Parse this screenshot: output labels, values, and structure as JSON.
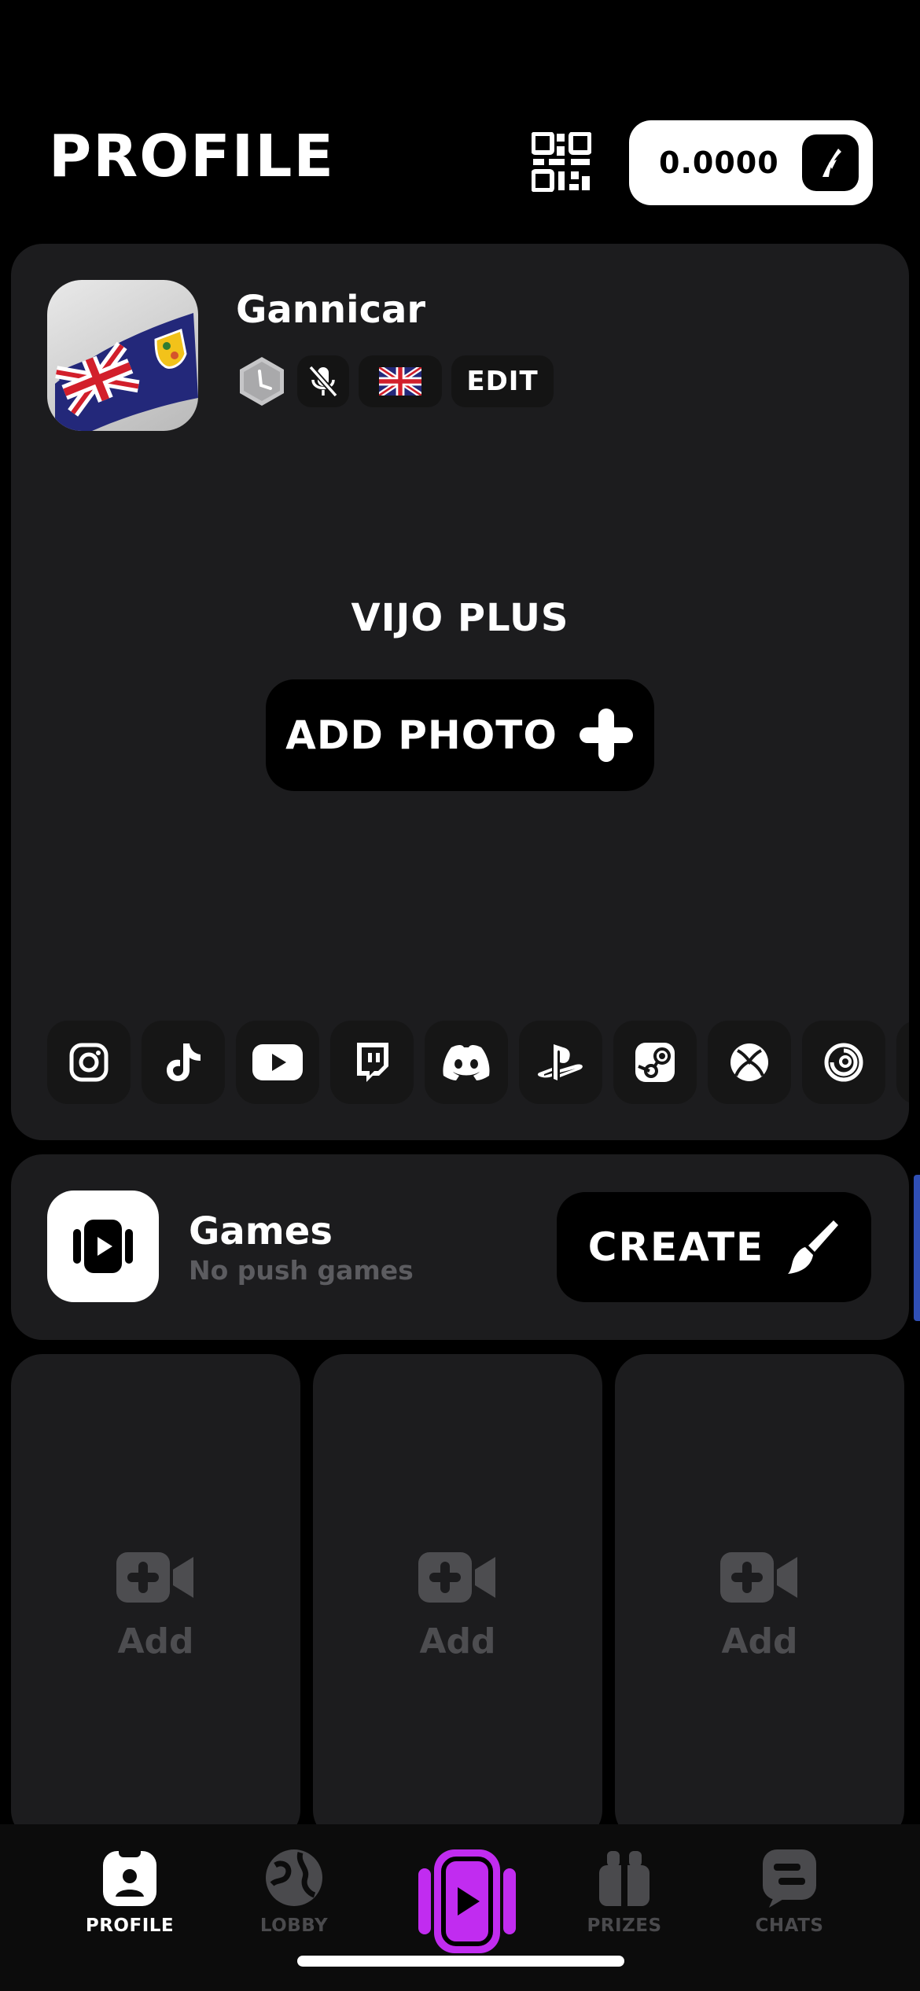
{
  "header": {
    "title": "PROFILE",
    "qr_icon": "qr-code-icon",
    "balance": "0.0000",
    "balance_icon": "bolt-icon"
  },
  "profile": {
    "username": "Gannicar",
    "avatar_icon": "flag-avatar-icon",
    "badges": {
      "level_icon": "level-hexagon-icon",
      "mic_icon": "mic-muted-icon",
      "flag_icon": "uk-flag-icon",
      "edit_label": "EDIT"
    },
    "plus_title": "VIJO PLUS",
    "add_photo_label": "ADD PHOTO",
    "socials": [
      "instagram-icon",
      "tiktok-icon",
      "youtube-icon",
      "twitch-icon",
      "discord-icon",
      "playstation-icon",
      "steam-icon",
      "xbox-icon",
      "ubisoft-icon"
    ]
  },
  "games": {
    "title": "Games",
    "subtitle": "No push games",
    "create_label": "CREATE"
  },
  "slots": [
    {
      "label": "Add"
    },
    {
      "label": "Add"
    },
    {
      "label": "Add"
    }
  ],
  "tabbar": {
    "tabs": [
      {
        "label": "PROFILE",
        "icon": "profile-icon",
        "active": true
      },
      {
        "label": "LOBBY",
        "icon": "globe-icon",
        "active": false
      },
      {
        "label": "",
        "icon": "play-icon",
        "active": false
      },
      {
        "label": "PRIZES",
        "icon": "gift-icon",
        "active": false
      },
      {
        "label": "CHATS",
        "icon": "chat-icon",
        "active": false
      }
    ]
  },
  "colors": {
    "background": "#000000",
    "card": "#1c1c1e",
    "accent": "#c12cf0",
    "muted": "#4d4d50"
  }
}
